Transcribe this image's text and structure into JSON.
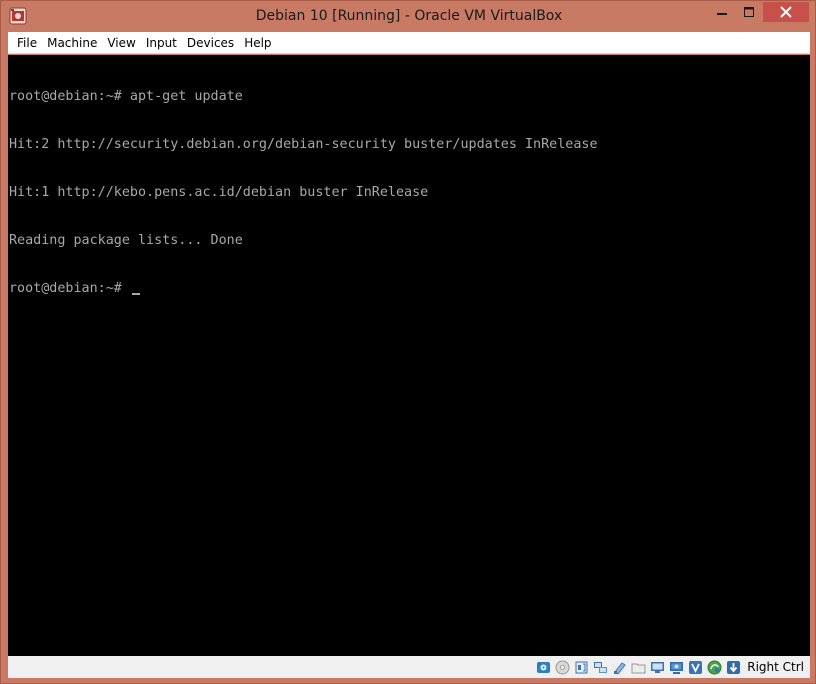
{
  "window": {
    "title": "Debian 10 [Running] - Oracle VM VirtualBox",
    "icon": "virtualbox-vm-icon",
    "colors": {
      "frame": "#c97a64",
      "close": "#c7504a"
    }
  },
  "menu": {
    "items": [
      {
        "label": "File"
      },
      {
        "label": "Machine"
      },
      {
        "label": "View"
      },
      {
        "label": "Input"
      },
      {
        "label": "Devices"
      },
      {
        "label": "Help"
      }
    ]
  },
  "console": {
    "lines": [
      "root@debian:~# apt-get update",
      "Hit:2 http://security.debian.org/debian-security buster/updates InRelease",
      "Hit:1 http://kebo.pens.ac.id/debian buster InRelease",
      "Reading package lists... Done",
      "root@debian:~# "
    ],
    "colors": {
      "background": "#000000",
      "text": "#a8a8a8"
    }
  },
  "statusbar": {
    "icons": [
      "hard-disk-icon",
      "optical-drive-icon",
      "audio-icon",
      "network-icon",
      "usb-icon",
      "shared-folders-icon",
      "display-icon",
      "video-capture-icon",
      "vrde-icon",
      "mouse-integration-icon",
      "host-key-arrow-icon"
    ],
    "host_key": "Right Ctrl"
  }
}
